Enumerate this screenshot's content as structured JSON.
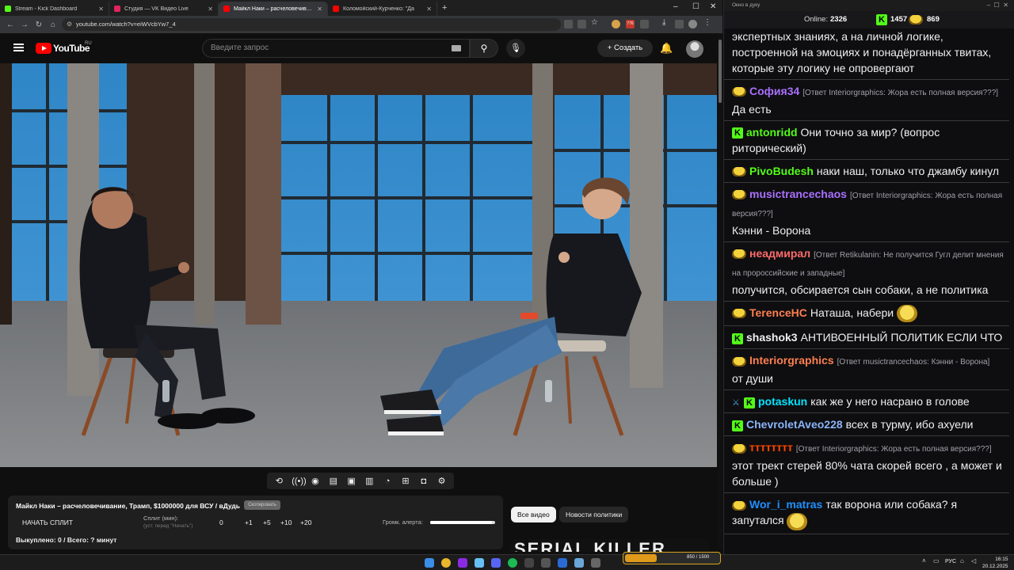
{
  "browser": {
    "tabs": [
      {
        "title": "Stream - Kick Dashboard",
        "color": "#53fc18"
      },
      {
        "title": "Студия — VK Видео Live",
        "color": "#e0245e"
      },
      {
        "title": "Майкл Наки – расчеловечивание",
        "color": "#ff0000"
      },
      {
        "title": "Коломойский-Курченко: \"Да",
        "color": "#ff0000"
      }
    ],
    "url": "youtube.com/watch?v=eiWVcbYw7_4",
    "counter_badge": "776"
  },
  "youtube": {
    "logo_text": "YouTube",
    "region": "RU",
    "search_placeholder": "Введите запрос",
    "create_label": "Создать"
  },
  "extension": {
    "video_title": "Майкл Наки – расчеловечивание, Трамп, $1000000 для ВСУ / вДудь",
    "copy_label": "Скопировать",
    "start_split_label": "НАЧАТЬ СПЛИТ",
    "split_label": "Сплит (мин):",
    "split_hint": "(уст. перед \"Начать\")",
    "split_values": [
      "0",
      "+1",
      "+5",
      "+10",
      "+20"
    ],
    "alert_volume_label": "Громк. алерта:",
    "burned_text": "Выкуплено: 0 / Всего: ? минут",
    "alert_volume": 0.95
  },
  "chips": {
    "all": "Все видео",
    "news": "Новости политики"
  },
  "up_next_thumb_text": "SERIAL    KILLER",
  "chat": {
    "window_title": "Окно в дуку",
    "online_label": "Online:",
    "online": "2326",
    "kick_count": "1457",
    "twitch_count": "869",
    "messages": [
      {
        "badges": [],
        "user": "",
        "color": "#efeff1",
        "reply": "",
        "text": "экспертных знаниях, а на личной логике, построенной на эмоциях и понадёрганных твитах, которые эту логику не опровергают",
        "emoji": false
      },
      {
        "badges": [
          "twitch"
        ],
        "user": "София34",
        "color": "#a970ff",
        "reply": "[Ответ Interiorgraphics: Жора есть полная версия???]",
        "text": "Да есть",
        "emoji": false
      },
      {
        "badges": [
          "kick"
        ],
        "user": "antonridd",
        "color": "#53fc18",
        "reply": "",
        "text": "Они точно за мир? (вопрос риторический)",
        "emoji": false
      },
      {
        "badges": [
          "twitch"
        ],
        "user": "PivoBudesh",
        "color": "#53fc18",
        "reply": "",
        "text": "наки наш, только что джамбу кинул",
        "emoji": false
      },
      {
        "badges": [
          "twitch"
        ],
        "user": "musictrancechaos",
        "color": "#a970ff",
        "reply": "[Ответ Interiorgraphics: Жора есть полная версия???]",
        "text": "Кэнни - Ворона",
        "emoji": false
      },
      {
        "badges": [
          "twitch"
        ],
        "user": "неадмирал",
        "color": "#ff6b6b",
        "reply": "[Ответ Retikulanin: Не получится Гугл делит мнения на пророссийские и западные]",
        "text": "получится, обсирается сын собаки, а не политика",
        "emoji": false
      },
      {
        "badges": [
          "twitch"
        ],
        "user": "TerenceHC",
        "color": "#ff7f50",
        "reply": "",
        "text": "Наташа, набери",
        "emoji": true
      },
      {
        "badges": [
          "kick"
        ],
        "user": "shashok3",
        "color": "#efeff1",
        "reply": "",
        "text": "АНТИВОЕННЫЙ ПОЛИТИК ЕСЛИ ЧТО",
        "emoji": false
      },
      {
        "badges": [
          "twitch"
        ],
        "user": "Interiorgraphics",
        "color": "#ff7f50",
        "reply": "[Ответ musictrancechaos: Кэнни - Ворона]",
        "text": "от души",
        "emoji": false
      },
      {
        "badges": [
          "sword",
          "kick"
        ],
        "user": "potaskun",
        "color": "#00e5ff",
        "reply": "",
        "text": "как же у него насрано в голове",
        "emoji": false
      },
      {
        "badges": [
          "kick"
        ],
        "user": "ChevroletAveo228",
        "color": "#8ab4f8",
        "reply": "",
        "text": "всех в турму, ибо ахуели",
        "emoji": false
      },
      {
        "badges": [
          "twitch"
        ],
        "user": "тттттттт",
        "color": "#ff4500",
        "reply": "[Ответ Interiorgraphics: Жора есть полная версия???]",
        "text": "этот трект стерей 80% чата скорей всего , а может и больше )",
        "emoji": false
      },
      {
        "badges": [
          "twitch"
        ],
        "user": "Wor_i_matras",
        "color": "#1e90ff",
        "reply": "",
        "text": "так ворона или собака? я запутался",
        "emoji": true
      }
    ]
  },
  "taskbar": {
    "language": "РУС",
    "time": "16:15",
    "date": "20.12.2025",
    "widget_text": "850 / 1500"
  }
}
